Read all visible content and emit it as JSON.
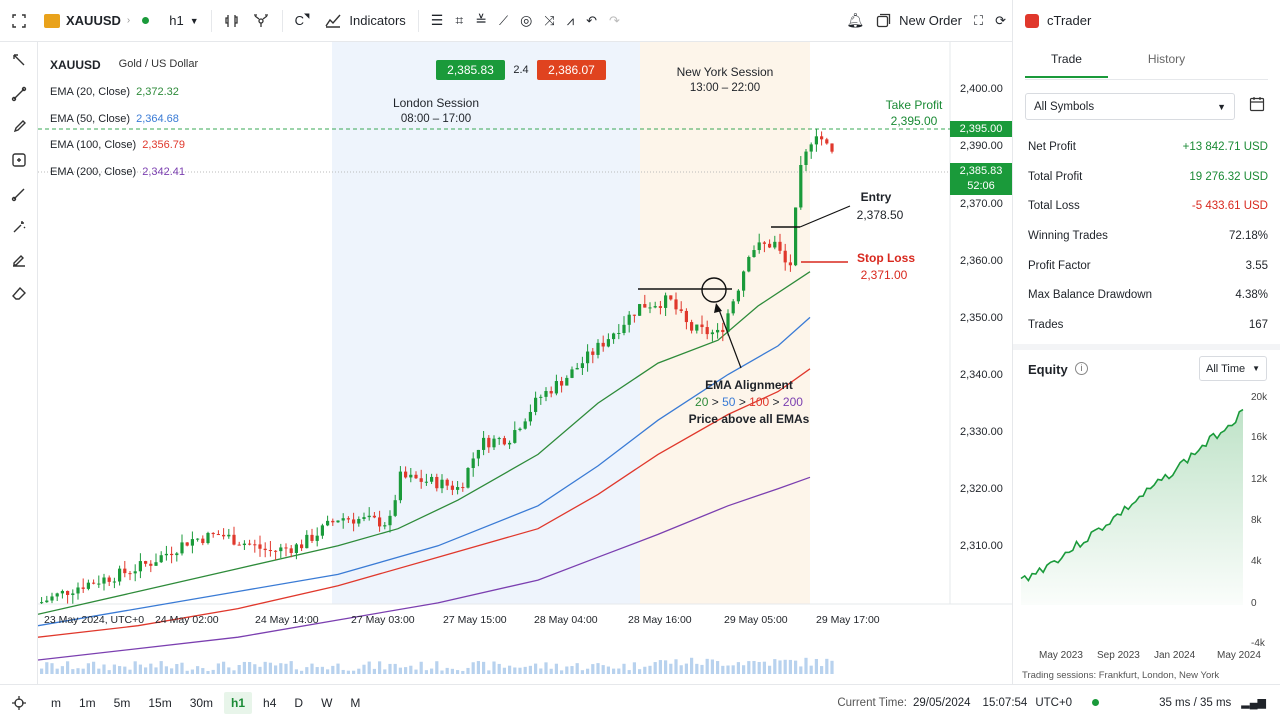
{
  "topbar": {
    "symbol": "XAUUSD",
    "timeframe": "h1",
    "c_label": "C",
    "indicators_label": "Indicators",
    "new_order_label": "New Order"
  },
  "chart": {
    "symbol": "XAUUSD",
    "description": "Gold / US Dollar",
    "bid": "2,385.83",
    "spread": "2.4",
    "ask": "2,386.07",
    "emas": [
      {
        "label": "EMA (20, Close)",
        "value": "2,372.32",
        "color": "#2e8b3a"
      },
      {
        "label": "EMA (50, Close)",
        "value": "2,364.68",
        "color": "#3a7bd5"
      },
      {
        "label": "EMA (100, Close)",
        "value": "2,356.79",
        "color": "#e0382c"
      },
      {
        "label": "EMA (200, Close)",
        "value": "2,342.41",
        "color": "#7b3fb0"
      }
    ],
    "london": {
      "title": "London Session",
      "hours": "08:00 – 17:00"
    },
    "newyork": {
      "title": "New York Session",
      "hours": "13:00 – 22:00"
    },
    "take_profit": {
      "title": "Take Profit",
      "price": "2,395.00"
    },
    "entry": {
      "title": "Entry",
      "price": "2,378.50"
    },
    "stop_loss": {
      "title": "Stop Loss",
      "price": "2,371.00"
    },
    "ema_alignment": {
      "title": "EMA Alignment",
      "n20": "20",
      "n50": "50",
      "n100": "100",
      "n200": "200",
      "gt": ">",
      "note": "Price above all EMAs"
    },
    "price_axis": [
      "2,400.00",
      "2,390.00",
      "2,370.00",
      "2,360.00",
      "2,350.00",
      "2,340.00",
      "2,330.00",
      "2,320.00",
      "2,310.00"
    ],
    "tp_tag": "2,395.00",
    "current_price_tag": "2,385.83",
    "countdown_tag": "52:06",
    "time_axis": [
      "23 May 2024, UTC+0",
      "24 May 02:00",
      "24 May 14:00",
      "27 May 03:00",
      "27 May 15:00",
      "28 May 04:00",
      "28 May 16:00",
      "29 May 05:00",
      "29 May 17:00"
    ]
  },
  "timeframes": [
    "m",
    "1m",
    "5m",
    "15m",
    "30m",
    "h1",
    "h4",
    "D",
    "W",
    "M"
  ],
  "status": {
    "current_time_label": "Current Time:",
    "date": "29/05/2024",
    "time": "15:07:54",
    "tz": "UTC+0",
    "latency": "35 ms / 35 ms"
  },
  "panel": {
    "title": "cTrader",
    "tabs": [
      "Trade",
      "History"
    ],
    "filter": "All Symbols",
    "stats": [
      {
        "label": "Net Profit",
        "value": "+13 842.71 USD",
        "color": "#1a8a35"
      },
      {
        "label": "Total Profit",
        "value": "19 276.32 USD",
        "color": "#1a8a35"
      },
      {
        "label": "Total Loss",
        "value": "-5 433.61 USD",
        "color": "#d8281e"
      },
      {
        "label": "Winning Trades",
        "value": "72.18%",
        "color": "#1f2329"
      },
      {
        "label": "Profit Factor",
        "value": "3.55",
        "color": "#1f2329"
      },
      {
        "label": "Max Balance Drawdown",
        "value": "4.38%",
        "color": "#1f2329"
      },
      {
        "label": "Trades",
        "value": "167",
        "color": "#1f2329"
      }
    ],
    "equity_title": "Equity",
    "range": "All Time",
    "equity_yaxis": [
      "20k",
      "16k",
      "12k",
      "8k",
      "4k",
      "0",
      "-4k"
    ],
    "equity_xaxis": [
      "May 2023",
      "Sep 2023",
      "Jan 2024",
      "May 2024"
    ],
    "footer": "Trading sessions: Frankfurt, London, New York"
  },
  "colors": {
    "green": "#1a9a3a",
    "red": "#e0382c",
    "accent": "#1a8a35"
  }
}
